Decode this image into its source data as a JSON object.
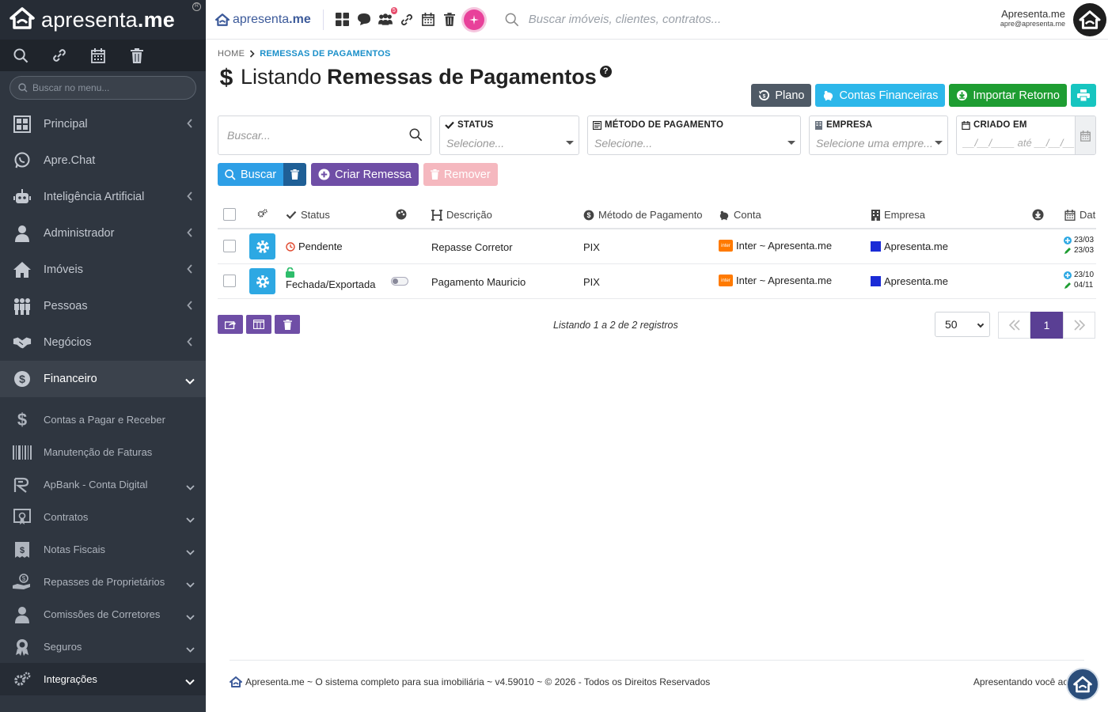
{
  "sidebar": {
    "logo_light": "apresenta",
    "logo_bold": ".me",
    "search_placeholder": "Buscar no menu...",
    "items": [
      {
        "label": "Principal",
        "icon": "dashboard-icon",
        "chevron": "left"
      },
      {
        "label": "Apre.Chat",
        "icon": "whatsapp-icon",
        "chevron": ""
      },
      {
        "label": "Inteligência Artificial",
        "icon": "robot-icon",
        "chevron": "left"
      },
      {
        "label": "Administrador",
        "icon": "user-tie-icon",
        "chevron": "left"
      },
      {
        "label": "Imóveis",
        "icon": "home-icon",
        "chevron": "left"
      },
      {
        "label": "Pessoas",
        "icon": "people-icon",
        "chevron": "left"
      },
      {
        "label": "Negócios",
        "icon": "handshake-icon",
        "chevron": "left"
      },
      {
        "label": "Financeiro",
        "icon": "dollar-circle-icon",
        "chevron": "down"
      }
    ],
    "sub_items": [
      {
        "label": "Contas a Pagar e Receber",
        "icon": "dollar-icon",
        "chevron": false
      },
      {
        "label": "Manutenção de Faturas",
        "icon": "barcode-icon",
        "chevron": false
      },
      {
        "label": "ApBank - Conta Digital",
        "icon": "bank-icon",
        "chevron": true
      },
      {
        "label": "Contratos",
        "icon": "contract-icon",
        "chevron": true
      },
      {
        "label": "Notas Fiscais",
        "icon": "invoice-icon",
        "chevron": true
      },
      {
        "label": "Repasses de Proprietários",
        "icon": "hand-coin-icon",
        "chevron": true
      },
      {
        "label": "Comissões de Corretores",
        "icon": "user-tie-icon",
        "chevron": true
      },
      {
        "label": "Seguros",
        "icon": "award-icon",
        "chevron": true
      },
      {
        "label": "Integrações",
        "icon": "gears-icon",
        "chevron": true
      }
    ]
  },
  "topbar": {
    "logo_light": "apresenta",
    "logo_bold": ".me",
    "badge_count": "5",
    "search_placeholder": "Buscar imóveis, clientes, contratos...",
    "user_name": "Apresenta.me",
    "user_email": "apre@apresenta.me"
  },
  "breadcrumb": {
    "home": "HOME",
    "current": "REMESSAS DE PAGAMENTOS"
  },
  "page": {
    "title_prefix": "Listando",
    "title_bold": "Remessas de Pagamentos",
    "help": "?"
  },
  "actions": {
    "plano": "Plano",
    "contas": "Contas Financeiras",
    "importar": "Importar Retorno"
  },
  "filters": {
    "search_placeholder": "Buscar...",
    "status_label": "STATUS",
    "status_value": "Selecione...",
    "metodo_label": "MÉTODO DE PAGAMENTO",
    "metodo_value": "Selecione...",
    "empresa_label": "EMPRESA",
    "empresa_value": "Selecione uma empre...",
    "criado_label": "CRIADO EM",
    "criado_value": "__/__/____ até __/__/__"
  },
  "filter_buttons": {
    "buscar": "Buscar",
    "criar": "Criar Remessa",
    "remover": "Remover"
  },
  "table": {
    "headers": {
      "status": "Status",
      "descricao": "Descrição",
      "metodo": "Método de Pagamento",
      "conta": "Conta",
      "empresa": "Empresa",
      "data": "Dat"
    },
    "rows": [
      {
        "status": "Pendente",
        "descricao": "Repasse Corretor",
        "metodo": "PIX",
        "conta": "Inter ~ Apresenta.me",
        "empresa": "Apresenta.me",
        "created": "23/03",
        "updated": "23/03"
      },
      {
        "status": "Fechada/Exportada",
        "descricao": "Pagamento Mauricio",
        "metodo": "PIX",
        "conta": "Inter ~ Apresenta.me",
        "empresa": "Apresenta.me",
        "created": "23/10",
        "updated": "04/11"
      }
    ]
  },
  "pagination": {
    "listing": "Listando 1 a 2 de 2 registros",
    "per_page": "50",
    "current_page": "1"
  },
  "footer": {
    "text": "Apresenta.me ~ O sistema completo para sua imobiliária ~ v4.59010 ~ © 2026 - Todos os Direitos Reservados",
    "right": "Apresentando você ao mu"
  },
  "colors": {
    "sidebar": "#2f3640",
    "accent_blue": "#2da8e3",
    "purple": "#6f4ea6",
    "green": "#1e9d32"
  }
}
